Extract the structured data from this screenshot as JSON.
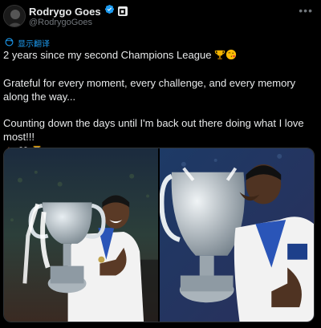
{
  "author": {
    "name": "Rodrygo Goes",
    "handle": "@RodrygoGoes"
  },
  "translate_label": "显示翻译",
  "tweet": {
    "line1": "2 years since my second Champions League",
    "line2": "Grateful for every moment, every challenge, and every memory along the way...",
    "line3": "Counting down the days until I'm back out there doing what I love most!!!"
  },
  "media": {
    "photo1_alt": "Player celebrating with trophy",
    "photo2_alt": "Player kissing trophy"
  },
  "colors": {
    "accent": "#1d9bf0",
    "text": "#e7e9ea",
    "muted": "#71767b",
    "background": "#000000"
  }
}
